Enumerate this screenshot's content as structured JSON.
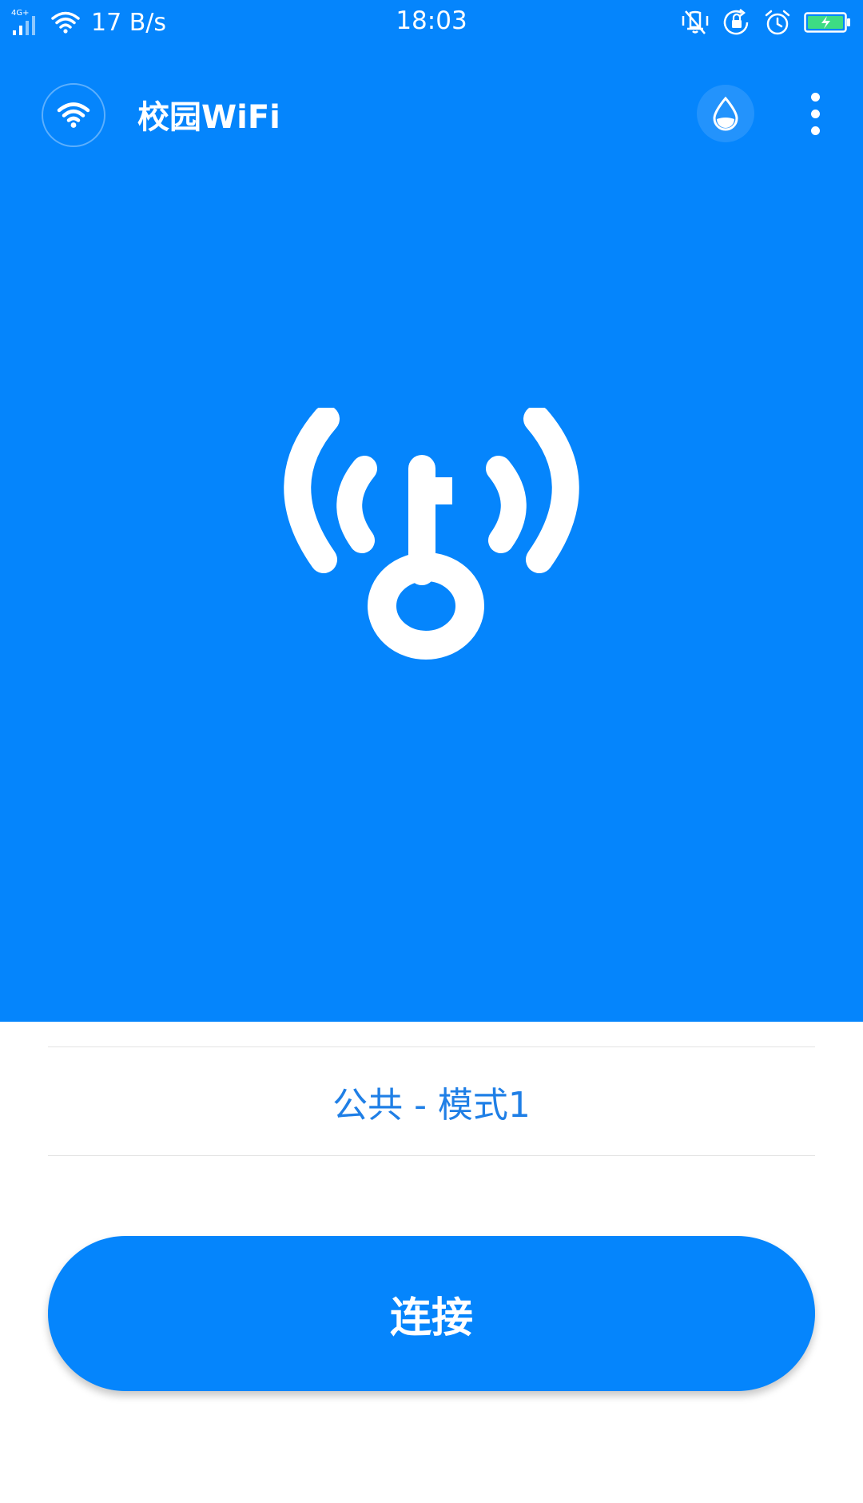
{
  "status_bar": {
    "network_type": "4G+",
    "net_speed": "17 B/s",
    "time": "18:03",
    "icons": [
      "signal-icon",
      "wifi-icon",
      "vibrate-icon",
      "rotation-lock-icon",
      "alarm-icon",
      "battery-charging-icon"
    ]
  },
  "app_bar": {
    "logo_icon": "wifi-icon",
    "title": "校园WiFi",
    "action_icons": [
      "water-drop-icon",
      "more-vert-icon"
    ]
  },
  "hero": {
    "icon": "wifi-key-icon"
  },
  "mode": {
    "label": "公共 - 模式1"
  },
  "connect": {
    "label": "连接"
  },
  "colors": {
    "primary": "#0585fc",
    "mode_text": "#1f7fe6",
    "battery_green": "#3ddc84",
    "white": "#ffffff"
  }
}
